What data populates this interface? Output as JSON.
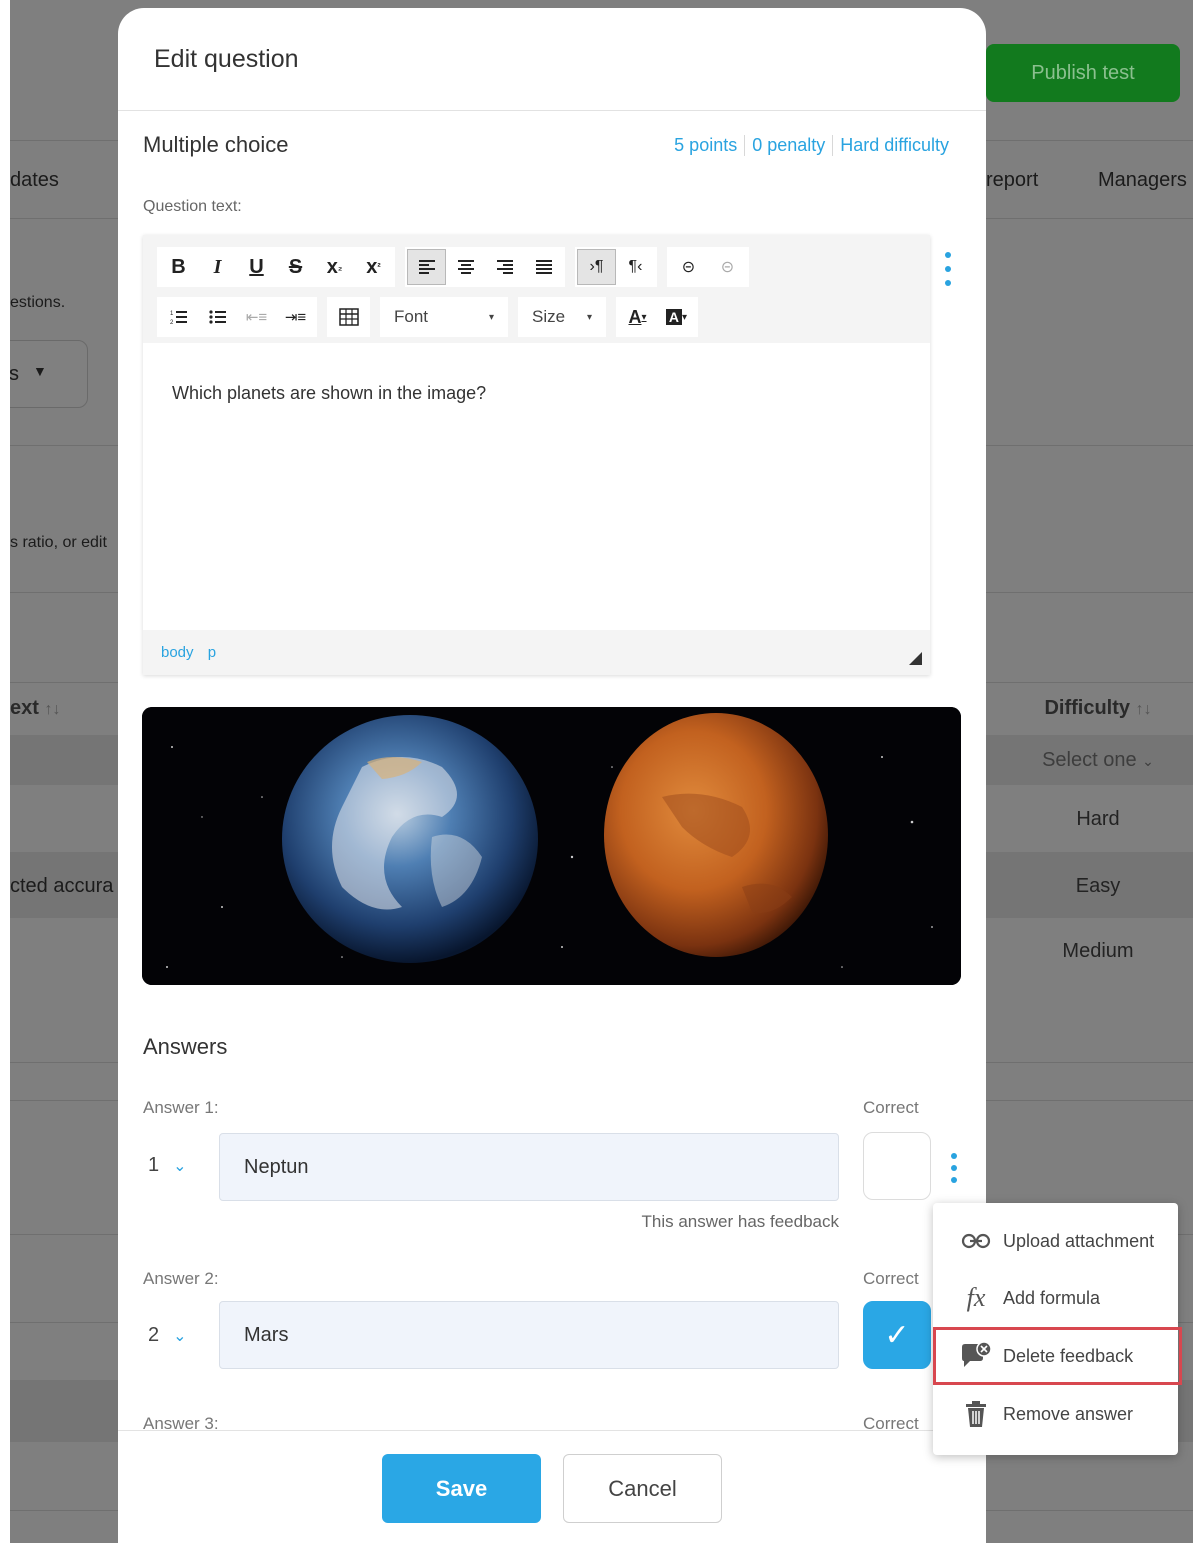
{
  "background": {
    "publish_button": "Publish test",
    "tabs": [
      "dates",
      "report",
      "Managers"
    ],
    "questions_hint": "estions.",
    "select_letter": "s",
    "ratio_hint": "s ratio, or edit",
    "col_text": "ext",
    "col_difficulty": "Difficulty",
    "filter_placeholder": "Select one",
    "rows": [
      {
        "text": "",
        "difficulty": "Hard"
      },
      {
        "text": "cted accura",
        "difficulty": "Easy"
      },
      {
        "text": "",
        "difficulty": "Medium"
      }
    ]
  },
  "modal": {
    "title": "Edit question",
    "question_type": "Multiple choice",
    "points": "5 points",
    "penalty": "0 penalty",
    "difficulty": "Hard difficulty",
    "question_label": "Question text:",
    "toolbar": {
      "font_label": "Font",
      "size_label": "Size"
    },
    "question_text": "Which planets are shown in the image?",
    "path": [
      "body",
      "p"
    ],
    "answers_title": "Answers",
    "correct_label": "Correct",
    "answers": [
      {
        "label": "Answer 1:",
        "num": "1",
        "value": "Neptun",
        "correct": false,
        "feedback_note": "This answer has feedback"
      },
      {
        "label": "Answer 2:",
        "num": "2",
        "value": "Mars",
        "correct": true
      },
      {
        "label": "Answer 3:"
      }
    ],
    "save_label": "Save",
    "cancel_label": "Cancel"
  },
  "context_menu": {
    "items": [
      {
        "label": "Upload attachment",
        "icon": "link-icon"
      },
      {
        "label": "Add formula",
        "icon": "fx-icon"
      },
      {
        "label": "Delete feedback",
        "icon": "delete-feedback-icon",
        "highlighted": true
      },
      {
        "label": "Remove answer",
        "icon": "trash-icon"
      }
    ]
  },
  "colors": {
    "accent": "#29a3e0",
    "publish_green": "#127a1e",
    "highlight_red": "#d8474f"
  }
}
